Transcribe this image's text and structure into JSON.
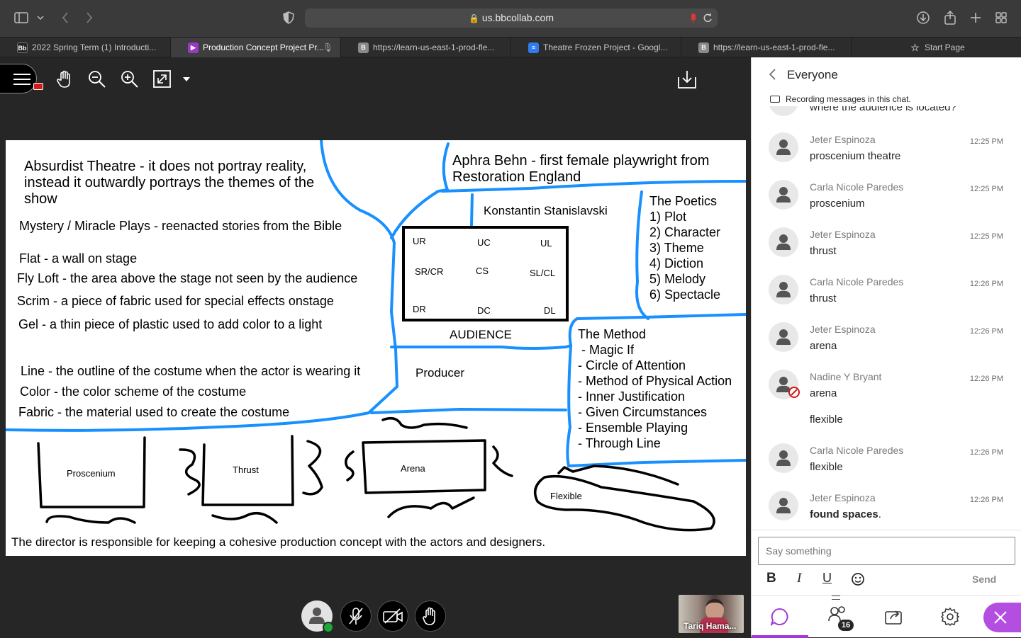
{
  "browser": {
    "url": "us.bbcollab.com",
    "tabs": [
      {
        "label": "2022 Spring Term (1) Introducti...",
        "favicon": "Bb"
      },
      {
        "label": "Production Concept Project Pr...",
        "favicon": "play"
      },
      {
        "label": "https://learn-us-east-1-prod-fle...",
        "favicon": "B"
      },
      {
        "label": "Theatre Frozen Project - Googl...",
        "favicon": "doc"
      },
      {
        "label": "https://learn-us-east-1-prod-fle...",
        "favicon": "B"
      },
      {
        "label": "Start Page",
        "favicon": "star"
      }
    ]
  },
  "board": {
    "notes": [
      "Absurdist Theatre - it does not portray reality,",
      "instead it outwardly portrays the themes of the",
      "show",
      "Mystery / Miracle Plays - reenacted stories from the Bible",
      "Flat - a wall on stage",
      "Fly Loft - the area above the stage not seen by the audience",
      "Scrim - a piece of fabric used for special effects onstage",
      "Gel - a thin piece of plastic used to add color to a light",
      "Line - the outline of the costume when the actor is wearing it",
      "Color - the color scheme of the costume",
      "Fabric - the material used to create the costume"
    ],
    "behn": [
      "Aphra Behn - first female playwright from",
      "Restoration England"
    ],
    "stanislavski": "Konstantin Stanislavski",
    "stage_positions": [
      "UR",
      "UC",
      "UL",
      "SR/CR",
      "CS",
      "SL/CL",
      "DR",
      "DC",
      "DL"
    ],
    "audience": "AUDIENCE",
    "producer": "Producer",
    "poetics": [
      "The Poetics",
      "1) Plot",
      "2) Character",
      "3) Theme",
      "4) Diction",
      "5) Melody",
      "6) Spectacle"
    ],
    "method": [
      "The Method",
      " - Magic If",
      "- Circle of Attention",
      "- Method of Physical Action",
      "- Inner Justification",
      "- Given Circumstances",
      "- Ensemble Playing",
      "- Through Line"
    ],
    "stage_types": [
      "Proscenium",
      "Thrust",
      "Arena",
      "Flexible"
    ],
    "footer": "The director is responsible for keeping a cohesive production concept with the actors and designers."
  },
  "chat": {
    "title": "Everyone",
    "recording_notice": "Recording messages in this chat.",
    "partial_message": "where the audience is located?",
    "messages": [
      {
        "name": "Jeter Espinoza",
        "time": "12:25 PM",
        "lines": [
          "proscenium theatre"
        ]
      },
      {
        "name": "Carla Nicole Paredes",
        "time": "12:25 PM",
        "lines": [
          "proscenium"
        ]
      },
      {
        "name": "Jeter Espinoza",
        "time": "12:25 PM",
        "lines": [
          "thrust"
        ]
      },
      {
        "name": "Carla Nicole Paredes",
        "time": "12:26 PM",
        "lines": [
          "thrust"
        ]
      },
      {
        "name": "Jeter Espinoza",
        "time": "12:26 PM",
        "lines": [
          "arena"
        ]
      },
      {
        "name": "Nadine Y Bryant",
        "time": "12:26 PM",
        "lines": [
          "arena",
          "flexible"
        ]
      },
      {
        "name": "Carla Nicole Paredes",
        "time": "12:26 PM",
        "lines": [
          "flexible"
        ]
      },
      {
        "name": "Jeter Espinoza",
        "time": "12:26 PM",
        "lines": [
          "found spaces."
        ],
        "bold": "found spaces"
      }
    ],
    "input_placeholder": "Say something",
    "send_label": "Send",
    "participant_count": "16"
  },
  "video": {
    "participant_name": "Tariq Hama..."
  },
  "colors": {
    "accent": "#a23bd6",
    "board_lines": "#1890ff",
    "recording": "#d11a1a",
    "status_ok": "#1fa83a"
  }
}
